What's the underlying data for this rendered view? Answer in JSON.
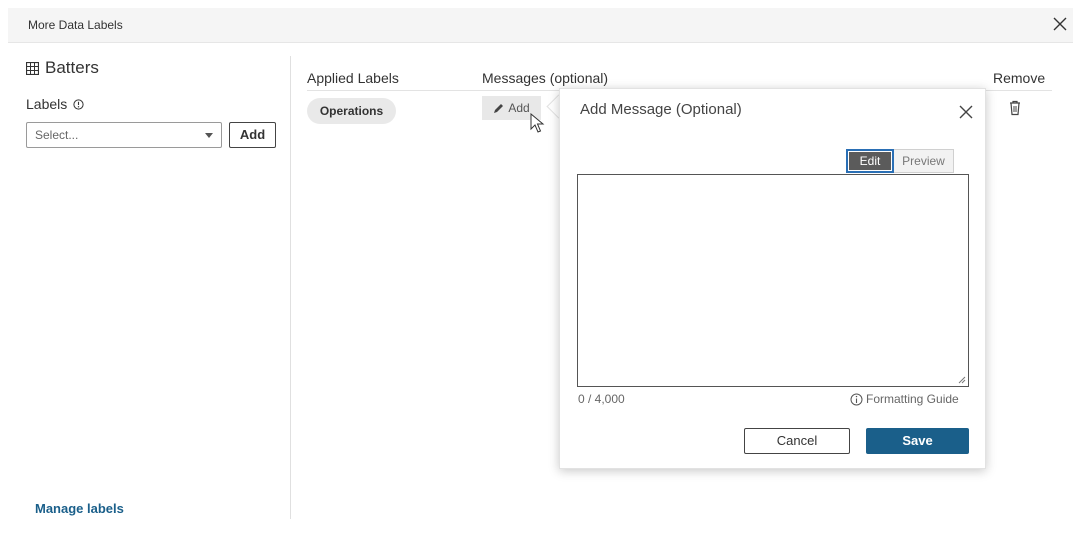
{
  "dialog": {
    "title": "More Data Labels"
  },
  "left": {
    "datasource_name": "Batters",
    "labels_heading": "Labels",
    "select_placeholder": "Select...",
    "add_label": "Add",
    "manage_link": "Manage labels"
  },
  "table": {
    "headers": {
      "applied": "Applied Labels",
      "messages": "Messages (optional)",
      "remove": "Remove"
    },
    "rows": [
      {
        "label": "Operations",
        "message_action": "Add"
      }
    ]
  },
  "popover": {
    "title": "Add Message (Optional)",
    "tabs": {
      "edit": "Edit",
      "preview": "Preview"
    },
    "char_count": "0 / 4,000",
    "formatting_guide": "Formatting Guide",
    "cancel": "Cancel",
    "save": "Save"
  },
  "colors": {
    "accent": "#1a5f8a",
    "edit_tab_bg": "#5b5b5b",
    "focus_ring": "#2a6fb5"
  },
  "icons": [
    "close-icon",
    "table-icon",
    "info-icon",
    "pencil-icon",
    "trash-icon",
    "cursor-icon",
    "resize-grip-icon"
  ]
}
